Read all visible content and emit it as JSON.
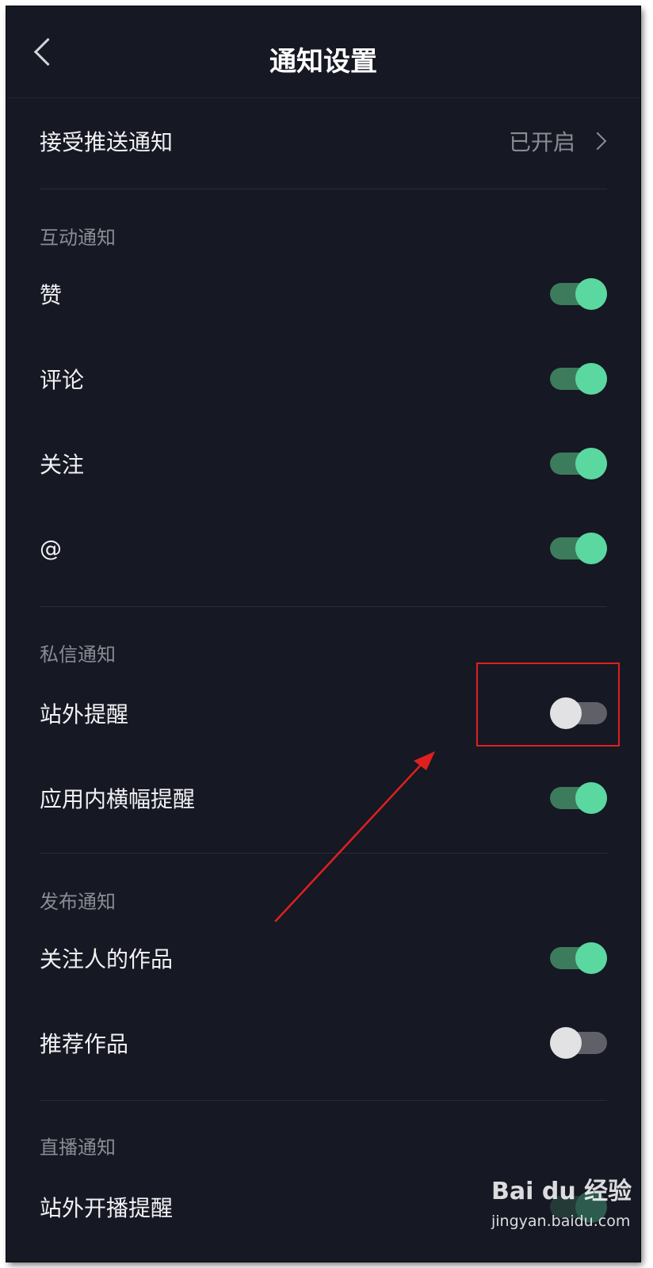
{
  "header": {
    "title": "通知设置"
  },
  "push": {
    "label": "接受推送通知",
    "value": "已开启"
  },
  "sections": {
    "interaction": {
      "title": "互动通知",
      "items": [
        {
          "label": "赞",
          "on": true
        },
        {
          "label": "评论",
          "on": true
        },
        {
          "label": "关注",
          "on": true
        },
        {
          "label": "@",
          "on": true
        }
      ]
    },
    "message": {
      "title": "私信通知",
      "items": [
        {
          "label": "站外提醒",
          "on": false
        },
        {
          "label": "应用内横幅提醒",
          "on": true
        }
      ]
    },
    "publish": {
      "title": "发布通知",
      "items": [
        {
          "label": "关注人的作品",
          "on": true
        },
        {
          "label": "推荐作品",
          "on": false
        }
      ]
    },
    "live": {
      "title": "直播通知",
      "items": [
        {
          "label": "站外开播提醒"
        }
      ]
    }
  },
  "watermark": {
    "brand": "Bai du 经验",
    "url": "jingyan.baidu.com"
  },
  "colors": {
    "background": "#161823",
    "toggle_on": "#5ad8a0",
    "annotation": "#e02020"
  }
}
